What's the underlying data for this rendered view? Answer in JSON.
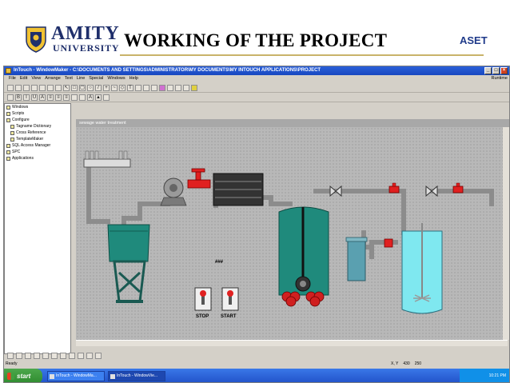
{
  "slide": {
    "logo_text": "AMITY",
    "logo_sub": "UNIVERSITY",
    "title": "WORKING OF THE PROJECT",
    "tag": "ASET"
  },
  "window": {
    "title": "InTouch - WindowMaker - C:\\DOCUMENTS AND SETTINGS\\ADMINISTRATOR\\MY DOCUMENTS\\MY INTOUCH APPLICATIONS\\PROJECT",
    "menu": [
      "File",
      "Edit",
      "View",
      "Arrange",
      "Text",
      "Line",
      "Special",
      "Windows",
      "Help"
    ],
    "runtime_label": "Runtime"
  },
  "tree": {
    "items": [
      {
        "label": "Windows",
        "child": false
      },
      {
        "label": "Scripts",
        "child": false
      },
      {
        "label": "Configure",
        "child": false
      },
      {
        "label": "Tagname Dictionary",
        "child": true
      },
      {
        "label": "Cross Reference",
        "child": true
      },
      {
        "label": "TemplateMaker",
        "child": true
      },
      {
        "label": "SQL Access Manager",
        "child": false
      },
      {
        "label": "SPC",
        "child": false
      },
      {
        "label": "Applications",
        "child": false
      }
    ]
  },
  "canvas": {
    "window_name": "sewage water treatment",
    "stop_label": "STOP",
    "start_label": "START",
    "hash_label": "###"
  },
  "status": {
    "ready": "Ready",
    "coord_label": "X, Y",
    "x": "430",
    "y": "250"
  },
  "taskbar": {
    "start_label": "start",
    "tasks": [
      "InTouch - WindowMa...",
      "InTouch - WindowVie..."
    ],
    "clock": "10:21 PM"
  },
  "colors": {
    "tank_teal": "#1f8a7c",
    "tank_cyan": "#7fe8f0",
    "valve_red": "#e02020",
    "pipe_gray": "#8c8c8c"
  }
}
